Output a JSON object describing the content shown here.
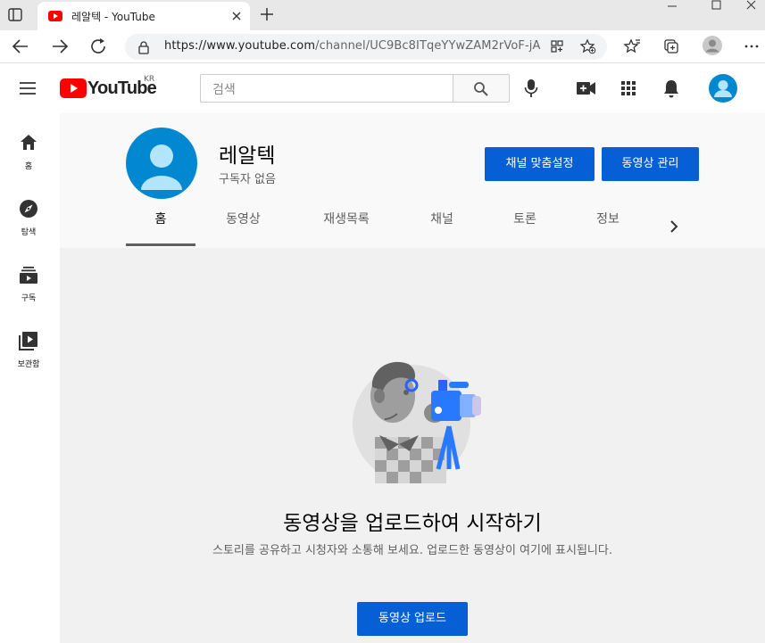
{
  "browser": {
    "tab_title": "레알텍 - YouTube",
    "url_main": "https://www.youtube.com",
    "url_rest": "/channel/UC9Bc8ITqeYYwZAM2rVoF-jA",
    "favicon_color": "#ff0000"
  },
  "youtube": {
    "logo_text": "YouTube",
    "region": "KR",
    "search_placeholder": "검색",
    "accent": "#065fd4"
  },
  "sidebar": {
    "items": [
      {
        "label": "홈",
        "icon": "home-icon"
      },
      {
        "label": "탐색",
        "icon": "compass-icon"
      },
      {
        "label": "구독",
        "icon": "subscriptions-icon"
      },
      {
        "label": "보관함",
        "icon": "library-icon"
      }
    ]
  },
  "channel": {
    "name": "레알텍",
    "subscribers": "구독자 없음",
    "customize_button": "채널 맞춤설정",
    "manage_button": "동영상 관리",
    "tabs": [
      "홈",
      "동영상",
      "재생목록",
      "채널",
      "토론",
      "정보"
    ]
  },
  "empty_state": {
    "heading": "동영상을 업로드하여 시작하기",
    "description": "스토리를 공유하고 시청자와 소통해 보세요. 업로드한 동영상이 여기에 표시됩니다.",
    "upload_button": "동영상 업로드"
  }
}
